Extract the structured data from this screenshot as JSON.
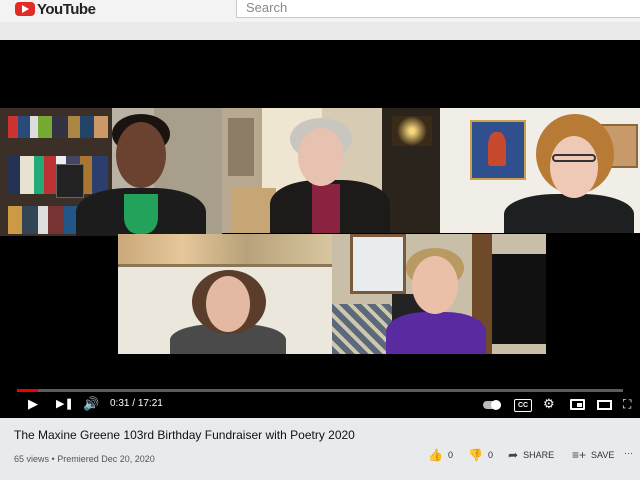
{
  "header": {
    "logo_text": "YouTube",
    "search_placeholder": "Search"
  },
  "player": {
    "progress_fraction": 0.034,
    "current_time": "0:31",
    "separator": "/",
    "duration": "17:21",
    "cc_label": "CC"
  },
  "video": {
    "title": "The Maxine Greene 103rd Birthday Fundraiser with Poetry 2020",
    "views": "65 views",
    "dot": "•",
    "premiered": "Premiered Dec 20, 2020"
  },
  "actions": {
    "likes": "0",
    "dislikes": "0",
    "share_label": "SHARE",
    "save_label": "SAVE",
    "more_glyph": "···"
  },
  "icons": {
    "play": "play-icon",
    "next": "next-icon",
    "volume": "volume-icon",
    "autoplay": "autoplay-toggle-icon",
    "settings": "gear-icon",
    "miniplayer": "miniplayer-icon",
    "theater": "theater-icon",
    "fullscreen": "fullscreen-icon"
  },
  "colors": {
    "brand_red": "#e12b25",
    "progress_red": "#ee0000",
    "player_bg": "#000000"
  }
}
